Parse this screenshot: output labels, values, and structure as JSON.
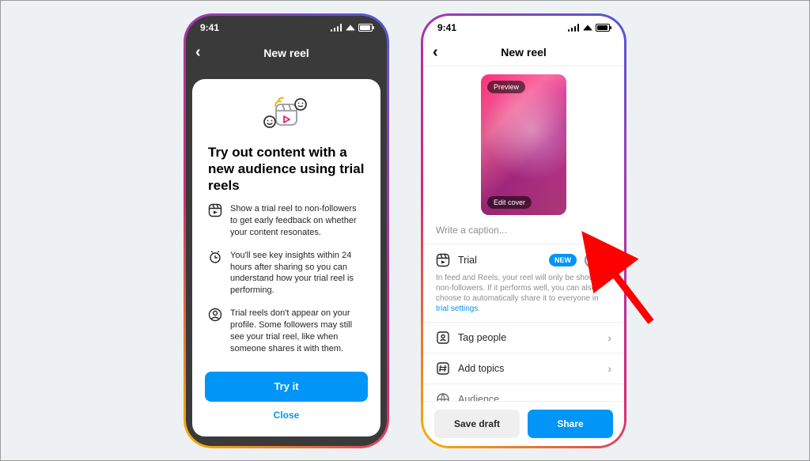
{
  "status": {
    "time": "9:41"
  },
  "left": {
    "header": "New reel",
    "modal": {
      "title": "Try out content with a new audience using trial reels",
      "items": [
        "Show a trial reel to non-followers to get early feedback on whether your content resonates.",
        "You'll see key insights within 24 hours after sharing so you can understand how your trial reel is performing.",
        "Trial reels don't appear on your profile. Some followers may still see your trial reel, like when someone shares it with them."
      ],
      "try_label": "Try it",
      "close_label": "Close"
    }
  },
  "right": {
    "header": "New reel",
    "preview_label": "Preview",
    "edit_cover_label": "Edit cover",
    "caption_placeholder": "Write a caption...",
    "trial": {
      "label": "Trial",
      "badge": "NEW",
      "desc_prefix": "In feed and Reels, your reel will only be shown to non-followers. If it performs well, you can also choose to automatically share it to everyone in ",
      "desc_link": "trial settings",
      "desc_suffix": "."
    },
    "tag_people": "Tag people",
    "add_topics": "Add topics",
    "audience": "Audience",
    "save_draft": "Save draft",
    "share": "Share"
  }
}
